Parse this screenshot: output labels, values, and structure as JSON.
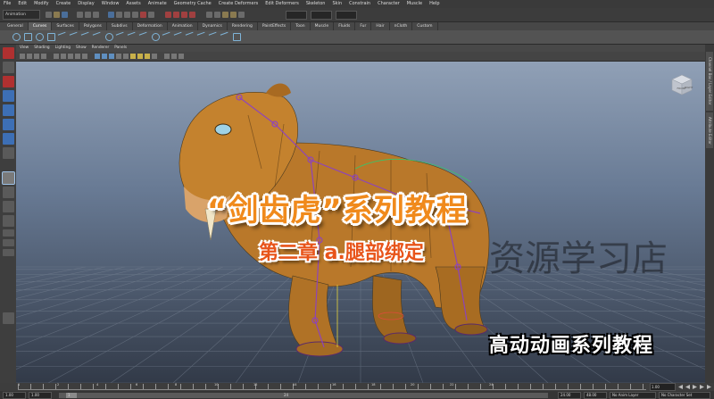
{
  "menubar": {
    "items": [
      "File",
      "Edit",
      "Modify",
      "Create",
      "Display",
      "Window",
      "Assets",
      "Animate",
      "Geometry Cache",
      "Create Deformers",
      "Edit Deformers",
      "Skeleton",
      "Skin",
      "Constrain",
      "Character",
      "Muscle",
      "Help"
    ]
  },
  "statusline": {
    "mode": "Animation"
  },
  "shelf": {
    "tabs": [
      "General",
      "Curves",
      "Surfaces",
      "Polygons",
      "Subdivs",
      "Deformation",
      "Animation",
      "Dynamics",
      "Rendering",
      "PaintEffects",
      "Toon",
      "Muscle",
      "Fluids",
      "Fur",
      "Hair",
      "nCloth",
      "Custom"
    ],
    "active_tab": "Curves"
  },
  "panel": {
    "menus": [
      "View",
      "Shading",
      "Lighting",
      "Show",
      "Renderer",
      "Panels"
    ]
  },
  "viewcube": {
    "front": "FRONT",
    "right": "RIGHT"
  },
  "right_tabs": [
    "Channel Box / Layer Editor",
    "Attribute Editor"
  ],
  "overlay": {
    "title": "“剑齿虎”系列教程",
    "subtitle": "第二章 a.腿部绑定",
    "watermark": "资源学习店",
    "series_caption": "高动动画系列教程"
  },
  "timeline": {
    "current_frame": "1.00",
    "ticks": [
      "1",
      "2",
      "4",
      "6",
      "8",
      "10",
      "12",
      "14",
      "16",
      "18",
      "20",
      "22",
      "24"
    ]
  },
  "range": {
    "start": "1.00",
    "playback_start": "1.00",
    "slider_label": "1",
    "slider_end_label": "24",
    "playback_end": "24.00",
    "end": "48.00",
    "anim_layer": "No Anim Layer",
    "character_set": "No Character Set"
  },
  "colors": {
    "accent": "#f08a1c",
    "viewport_top": "#90a0b6",
    "viewport_bottom": "#323a48",
    "tiger_body": "#b87a2a"
  }
}
